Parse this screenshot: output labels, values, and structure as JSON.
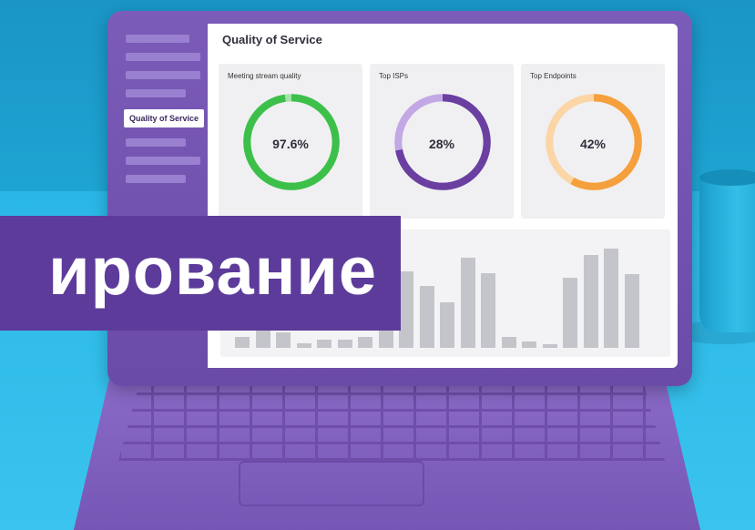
{
  "screen": {
    "title": "Quality of Service",
    "sidebar_active": "Quality of Service",
    "cards": [
      {
        "label": "Meeting stream quality",
        "value": "97.6%",
        "fraction": 0.976,
        "color": "#3cc04a",
        "track": "#a8e0ac"
      },
      {
        "label": "Top ISPs",
        "value": "28%",
        "fraction": 0.72,
        "color": "#6a3fa0",
        "track": "#c2a8e4"
      },
      {
        "label": "Top Endpoints",
        "value": "42%",
        "fraction": 0.58,
        "color": "#f5a03c",
        "track": "#fbd5a6"
      }
    ],
    "bars": [
      10,
      18,
      14,
      4,
      7,
      7,
      10,
      22,
      68,
      55,
      40,
      80,
      66,
      10,
      6,
      3,
      62,
      82,
      88,
      65
    ]
  },
  "banner": {
    "text": "ирование",
    "color": "#5d3b9a"
  }
}
